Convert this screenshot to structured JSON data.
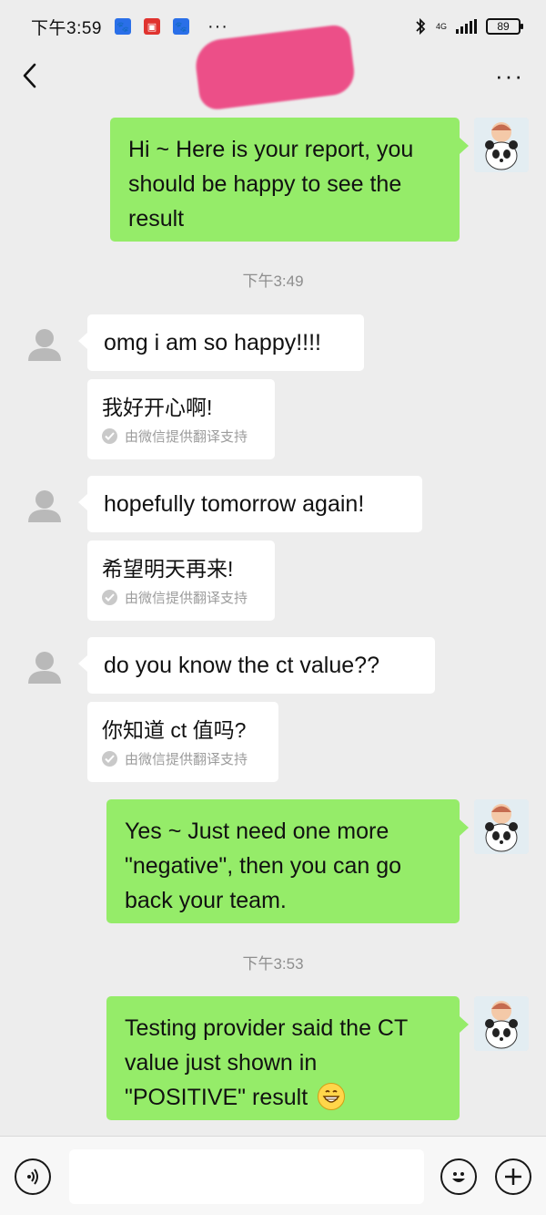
{
  "status_bar": {
    "time": "下午3:59",
    "more": "···",
    "network": "4G",
    "battery": "89"
  },
  "header": {
    "back_icon": "chevron-left-icon",
    "more_icon": "more-dots-icon",
    "more_label": "···"
  },
  "messages": [
    {
      "side": "out",
      "text": "Hi ~ Here is your report, you should be happy to see the result"
    },
    {
      "timestamp": "下午3:49"
    },
    {
      "side": "in",
      "text": "omg i am so happy!!!!",
      "translation": "我好开心啊!",
      "translation_credit": "由微信提供翻译支持"
    },
    {
      "side": "in",
      "text": "hopefully tomorrow again!",
      "translation": "希望明天再来!",
      "translation_credit": "由微信提供翻译支持"
    },
    {
      "side": "in",
      "text": "do you know the ct value??",
      "translation": "你知道 ct 值吗?",
      "translation_credit": "由微信提供翻译支持"
    },
    {
      "side": "out",
      "text": "Yes ~ Just need one more \"negative\", then you can go back your team."
    },
    {
      "timestamp": "下午3:53"
    },
    {
      "side": "out",
      "text": "Testing provider said the CT value just shown in \"POSITIVE\" result",
      "emoji": "grinning-emoji"
    }
  ],
  "input_bar": {
    "voice_icon": "voice-icon",
    "emoji_icon": "smiley-icon",
    "plus_icon": "plus-icon",
    "placeholder": ""
  },
  "colors": {
    "outgoing_bubble": "#95ec69",
    "incoming_bubble": "#ffffff",
    "background": "#ededed",
    "redaction": "#ec3f7e"
  }
}
